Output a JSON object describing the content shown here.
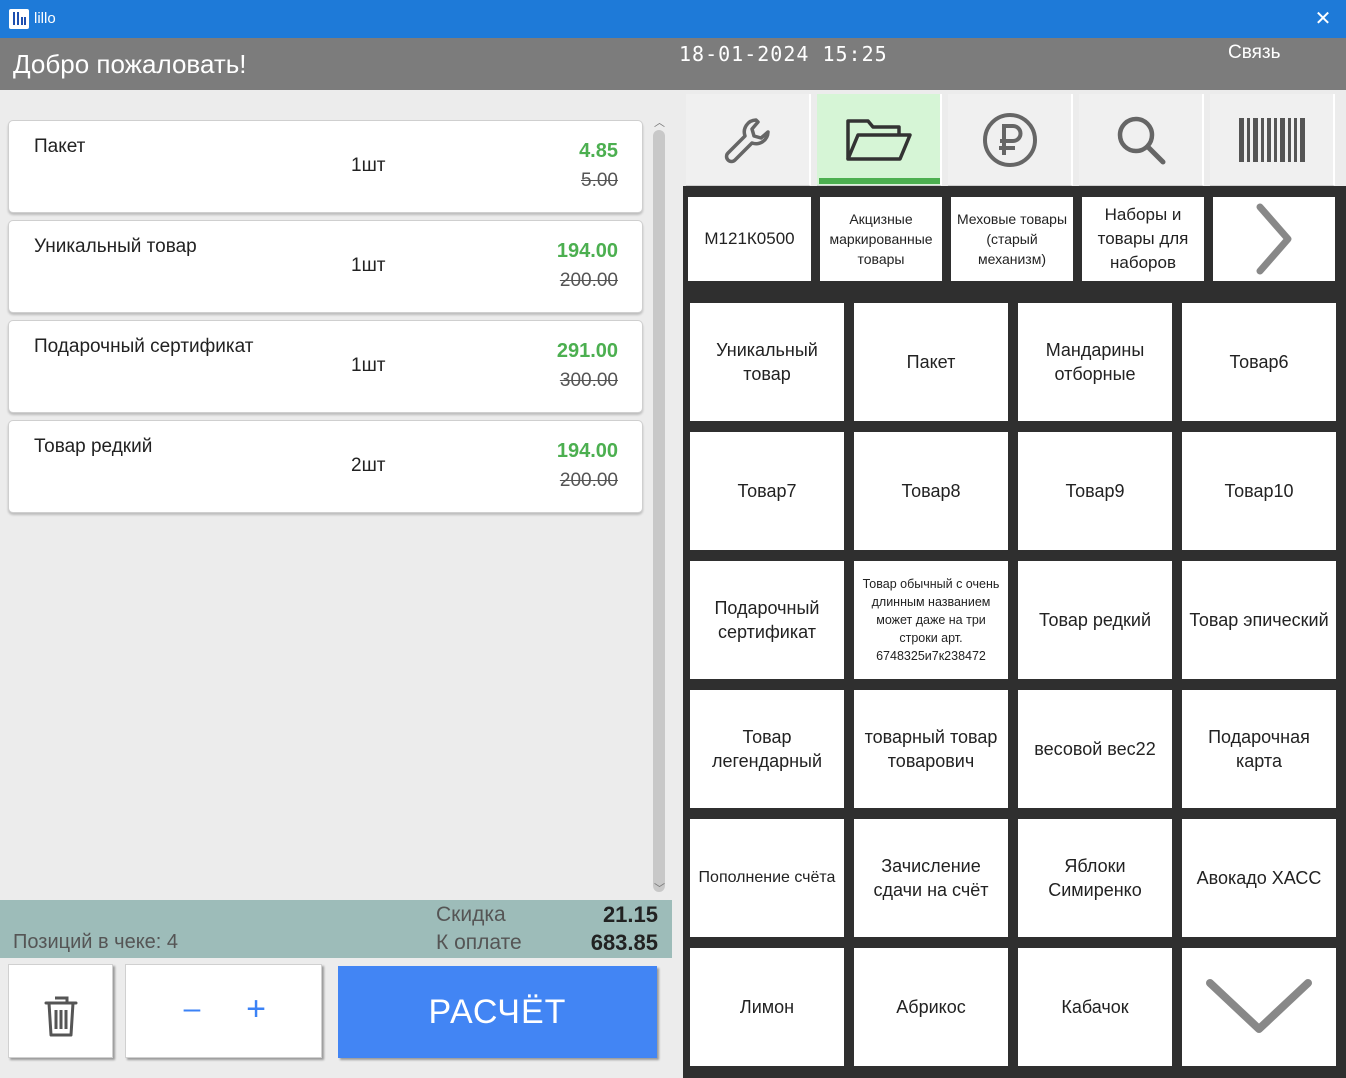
{
  "window": {
    "title": "lillo",
    "close_glyph": "✕"
  },
  "header": {
    "welcome": "Добро пожаловать!",
    "datetime": "18-01-2024 15:25",
    "connection": "Связь"
  },
  "receipt": {
    "items": [
      {
        "name": "Пакет",
        "qty": "1шт",
        "price": "4.85",
        "old_price": "5.00"
      },
      {
        "name": "Уникальный товар",
        "qty": "1шт",
        "price": "194.00",
        "old_price": "200.00"
      },
      {
        "name": "Подарочный сертификат",
        "qty": "1шт",
        "price": "291.00",
        "old_price": "300.00"
      },
      {
        "name": "Товар редкий",
        "qty": "2шт",
        "price": "194.00",
        "old_price": "200.00"
      }
    ]
  },
  "totals": {
    "positions": "Позиций в чеке: 4",
    "discount_label": "Скидка",
    "discount_value": "21.15",
    "pay_label": "К оплате",
    "pay_value": "683.85"
  },
  "actions": {
    "trash_icon": "trash-icon",
    "minus": "–",
    "plus": "+",
    "pay": "РАСЧЁТ"
  },
  "toolbar": {
    "tabs": [
      {
        "icon": "wrench-icon",
        "active": false
      },
      {
        "icon": "folder-open-icon",
        "active": true
      },
      {
        "icon": "ruble-icon",
        "active": false
      },
      {
        "icon": "search-icon",
        "active": false
      },
      {
        "icon": "barcode-icon",
        "active": false
      }
    ],
    "active_color": "#4caf50"
  },
  "categories": [
    "М121К0500",
    "Акцизные маркированные товары",
    "Меховые товары (старый механизм)",
    "Наборы и товары для наборов"
  ],
  "categories_next_icon": "chevron-right-icon",
  "products": [
    "Уникальный товар",
    "Пакет",
    "Мандарины отборные",
    "Товар6",
    "Товар7",
    "Товар8",
    "Товар9",
    "Товар10",
    "Подарочный сертификат",
    "Товар обычный с очень длинным названием может даже на три строки арт. 6748325и7к238472",
    "Товар редкий",
    "Товар эпический",
    "Товар легендарный",
    "товарный товар товарович",
    "весовой вес22",
    "Подарочная карта",
    "Пополнение счёта",
    "Зачисление сдачи на счёт",
    "Яблоки Симиренко",
    "Авокадо ХАСС",
    "Лимон",
    "Абрикос",
    "Кабачок"
  ],
  "products_next_icon": "chevron-down-icon",
  "colors": {
    "titlebar": "#1e7ad8",
    "header": "#7c7c7c",
    "price_green": "#4caf50",
    "pay_button": "#4285f4",
    "totals_bg": "#9dbcb9",
    "qty_buttons": "#3b82f6"
  }
}
